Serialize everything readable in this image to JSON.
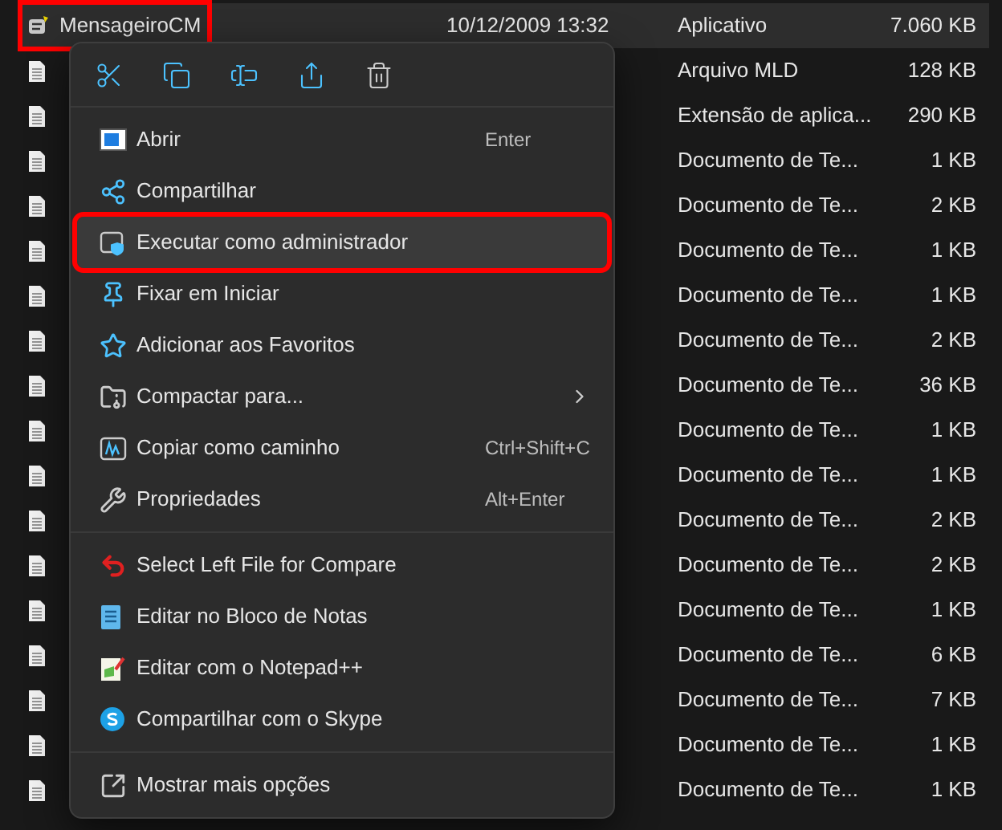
{
  "files": [
    {
      "name": "MensageiroCM",
      "date": "10/12/2009 13:32",
      "type": "Aplicativo",
      "size": "7.060 KB",
      "selected": true,
      "outlined": true
    },
    {
      "type": "Arquivo MLD",
      "size": "128 KB",
      "selected": false,
      "outlined": false
    },
    {
      "type": "Extensão de aplica...",
      "size": "290 KB",
      "selected": false,
      "outlined": false
    },
    {
      "type": "Documento de Te...",
      "size": "1 KB",
      "selected": false,
      "outlined": false
    },
    {
      "type": "Documento de Te...",
      "size": "2 KB",
      "selected": false,
      "outlined": false
    },
    {
      "type": "Documento de Te...",
      "size": "1 KB",
      "selected": false,
      "outlined": false
    },
    {
      "type": "Documento de Te...",
      "size": "1 KB",
      "selected": false,
      "outlined": false
    },
    {
      "type": "Documento de Te...",
      "size": "2 KB",
      "selected": false,
      "outlined": false
    },
    {
      "type": "Documento de Te...",
      "size": "36 KB",
      "selected": false,
      "outlined": false
    },
    {
      "type": "Documento de Te...",
      "size": "1 KB",
      "selected": false,
      "outlined": false
    },
    {
      "type": "Documento de Te...",
      "size": "1 KB",
      "selected": false,
      "outlined": false
    },
    {
      "type": "Documento de Te...",
      "size": "2 KB",
      "selected": false,
      "outlined": false
    },
    {
      "type": "Documento de Te...",
      "size": "2 KB",
      "selected": false,
      "outlined": false
    },
    {
      "type": "Documento de Te...",
      "size": "1 KB",
      "selected": false,
      "outlined": false
    },
    {
      "type": "Documento de Te...",
      "size": "6 KB",
      "selected": false,
      "outlined": false
    },
    {
      "type": "Documento de Te...",
      "size": "7 KB",
      "selected": false,
      "outlined": false
    },
    {
      "type": "Documento de Te...",
      "size": "1 KB",
      "selected": false,
      "outlined": false
    },
    {
      "type": "Documento de Te...",
      "size": "1 KB",
      "selected": false,
      "outlined": false
    }
  ],
  "context_menu": {
    "sections": [
      [
        {
          "label": "Abrir",
          "shortcut": "Enter",
          "submenu": false,
          "selected": false,
          "outlined": false
        },
        {
          "label": "Compartilhar",
          "submenu": false,
          "selected": false,
          "outlined": false
        },
        {
          "label": "Executar como administrador",
          "submenu": false,
          "selected": true,
          "outlined": true
        },
        {
          "label": "Fixar em Iniciar",
          "submenu": false,
          "selected": false,
          "outlined": false
        },
        {
          "label": "Adicionar aos Favoritos",
          "submenu": false,
          "selected": false,
          "outlined": false
        },
        {
          "label": "Compactar para...",
          "submenu": true,
          "selected": false,
          "outlined": false
        },
        {
          "label": "Copiar como caminho",
          "shortcut": "Ctrl+Shift+C",
          "submenu": false,
          "selected": false,
          "outlined": false
        },
        {
          "label": "Propriedades",
          "shortcut": "Alt+Enter",
          "submenu": false,
          "selected": false,
          "outlined": false
        }
      ],
      [
        {
          "label": "Select Left File for Compare",
          "submenu": false,
          "selected": false,
          "outlined": false
        },
        {
          "label": "Editar no Bloco de Notas",
          "submenu": false,
          "selected": false,
          "outlined": false
        },
        {
          "label": "Editar com o Notepad++",
          "submenu": false,
          "selected": false,
          "outlined": false
        },
        {
          "label": "Compartilhar com o Skype",
          "submenu": false,
          "selected": false,
          "outlined": false
        }
      ],
      [
        {
          "label": "Mostrar mais opções",
          "submenu": false,
          "selected": false,
          "outlined": false
        }
      ]
    ]
  }
}
